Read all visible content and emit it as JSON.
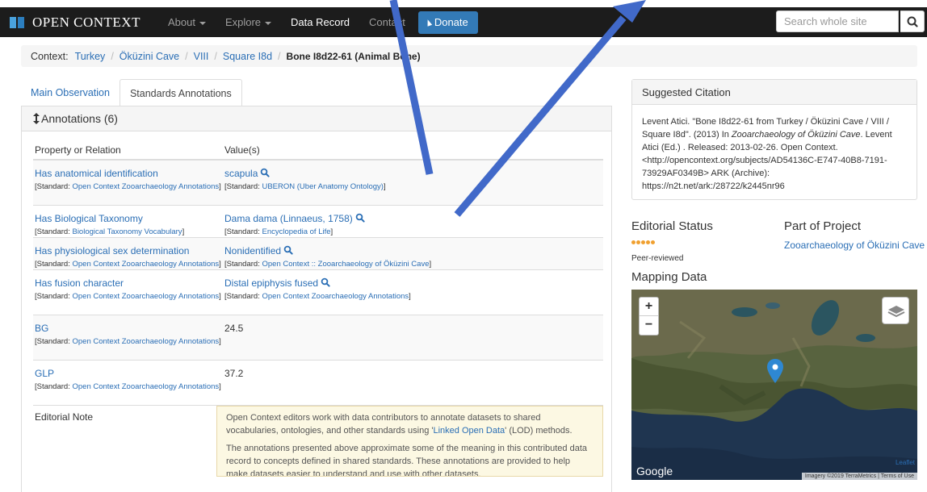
{
  "navbar": {
    "brand": "OPEN CONTEXT",
    "items": [
      {
        "label": "About",
        "dropdown": true
      },
      {
        "label": "Explore",
        "dropdown": true
      },
      {
        "label": "Data Record",
        "dropdown": false
      },
      {
        "label": "Contact",
        "dropdown": false
      }
    ],
    "donate_label": "Donate",
    "search_placeholder": "Search whole site"
  },
  "breadcrumb": {
    "label": "Context:",
    "links": [
      "Turkey",
      "Öküzini Cave",
      "VIII",
      "Square I8d"
    ],
    "current": "Bone I8d22-61 (Animal Bone)"
  },
  "tabs": [
    "Main Observation",
    "Standards Annotations"
  ],
  "annotations": {
    "heading": "Annotations (6)",
    "col_property": "Property or Relation",
    "col_values": "Value(s)",
    "standard_prefix": "[Standard: ",
    "standard_suffix": "]",
    "rows": [
      {
        "property": "Has anatomical identification",
        "property_standard": "Open Context Zooarchaeology Annotations",
        "value": "scapula",
        "value_standard": "UBERON (Uber Anatomy Ontology)",
        "value_link": true
      },
      {
        "property": "Has Biological Taxonomy",
        "property_standard": "Biological Taxonomy Vocabulary",
        "value": "Dama dama (Linnaeus, 1758)",
        "value_standard": "Encyclopedia of Life",
        "value_link": true
      },
      {
        "property": "Has physiological sex determination",
        "property_standard": "Open Context Zooarchaeology Annotations",
        "value": "Nonidentified",
        "value_standard": "Open Context :: Zooarchaeology of Öküzini Cave",
        "value_link": true
      },
      {
        "property": "Has fusion character",
        "property_standard": "Open Context Zooarchaeology Annotations",
        "value": "Distal epiphysis fused",
        "value_standard": "Open Context Zooarchaeology Annotations",
        "value_link": true
      },
      {
        "property": "BG",
        "property_standard": "Open Context Zooarchaeology Annotations",
        "value": "24.5",
        "value_standard": "",
        "value_link": false
      },
      {
        "property": "GLP",
        "property_standard": "Open Context Zooarchaeology Annotations",
        "value": "37.2",
        "value_standard": "",
        "value_link": false
      }
    ],
    "editorial_label": "Editorial Note",
    "editorial_p1_before": "Open Context editors work with data contributors to annotate datasets to shared vocabularies, ontologies, and other standards using '",
    "editorial_p1_link": "Linked Open Data",
    "editorial_p1_after": "' (LOD) methods.",
    "editorial_p2": "The annotations presented above approximate some of the meaning in this contributed data record to concepts defined in shared standards. These annotations are provided to help make datasets easier to understand and use with other datasets."
  },
  "citation": {
    "heading": "Suggested Citation",
    "part1": "Levent Atici. \"Bone I8d22-61 from Turkey / Öküzini Cave / VIII / Square I8d\". (2013) In ",
    "project_italic": "Zooarchaeology of Öküzini Cave",
    "part2": ". Levent Atici (Ed.) . Released: 2013-02-26. Open Context. <http://opencontext.org/subjects/AD54136C-E747-40B8-7191-73929AF0349B> ARK (Archive): https://n2t.net/ark:/28722/k2445nr96"
  },
  "editorial_status": {
    "title": "Editorial Status",
    "dots": 5,
    "text": "Peer-reviewed"
  },
  "project": {
    "title": "Part of Project",
    "link": "Zooarchaeology of Öküzini Cave"
  },
  "mapping": {
    "title": "Mapping Data",
    "zoom_in": "+",
    "zoom_out": "−",
    "google": "Google",
    "leaflet": "Leaflet",
    "attribution": "Imagery ©2019 TerraMetrics",
    "terms": "Terms of Use"
  },
  "colors": {
    "link": "#2a6eb5",
    "navbar": "#1c1c1c",
    "donate": "#337ab7",
    "arrow": "#4169c9",
    "status_dot": "#f0a030"
  }
}
